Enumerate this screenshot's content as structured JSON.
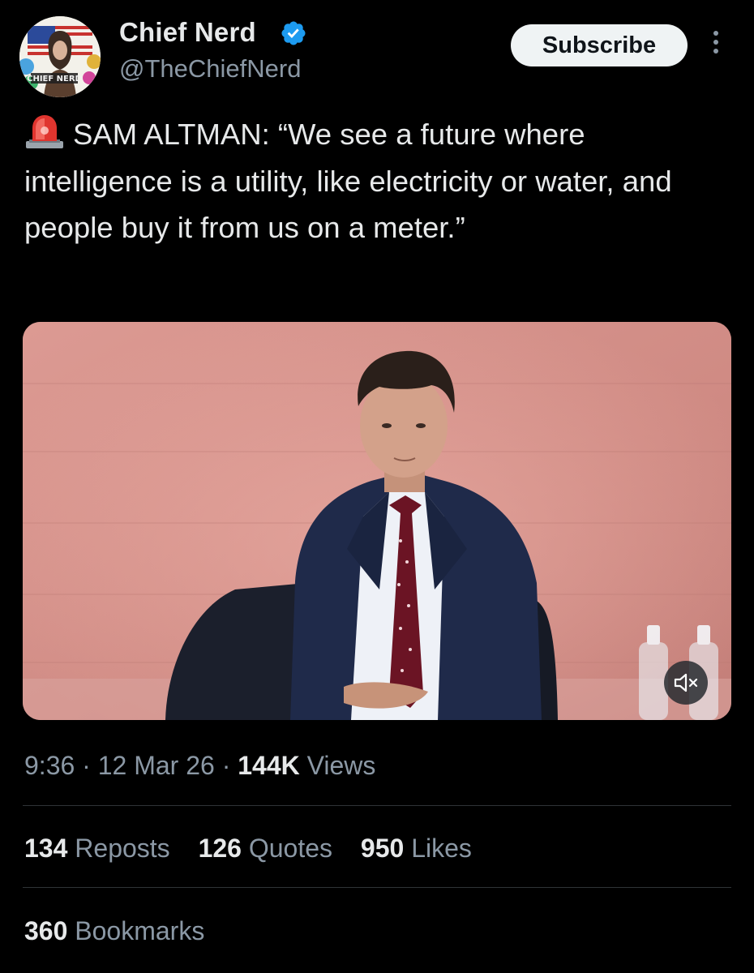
{
  "author": {
    "name": "Chief Nerd",
    "handle": "@TheChiefNerd",
    "avatar_text": "CHIEF NERD",
    "verified_color": "#1d9bf0"
  },
  "header": {
    "subscribe_label": "Subscribe",
    "more_icon": "more-vertical-icon"
  },
  "tweet": {
    "siren_icon": "police-siren-emoji",
    "text": "SAM ALTMAN: “We see a future where intelligence is a utility, like electricity or water, and people buy it from us on a meter.”"
  },
  "media": {
    "type": "video",
    "mute_icon": "speaker-muted-icon"
  },
  "meta": {
    "time": "9:36",
    "separator": "·",
    "date": "12 Mar 26",
    "views_count": "144K",
    "views_label": "Views"
  },
  "stats": {
    "reposts": {
      "count": "134",
      "label": "Reposts"
    },
    "quotes": {
      "count": "126",
      "label": "Quotes"
    },
    "likes": {
      "count": "950",
      "label": "Likes"
    },
    "bookmarks": {
      "count": "360",
      "label": "Bookmarks"
    }
  },
  "colors": {
    "background": "#000000",
    "text_primary": "#e7e9ea",
    "text_secondary": "#8b98a5",
    "divider": "#2f3336",
    "subscribe_bg": "#eff3f4"
  }
}
